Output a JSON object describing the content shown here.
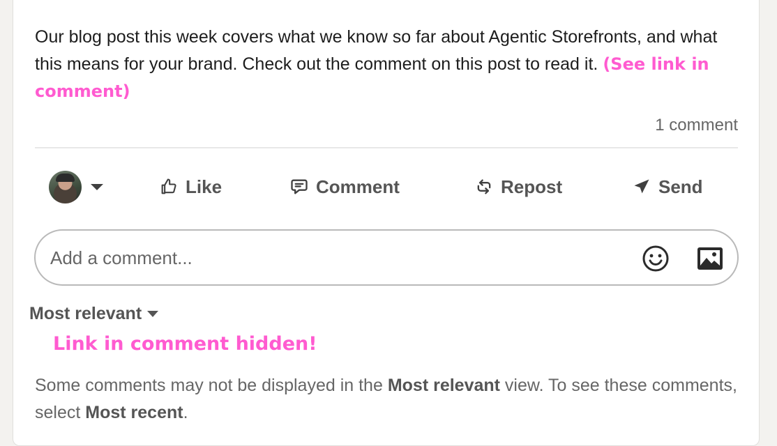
{
  "post": {
    "text": "Our blog post this week covers what we know so far about Agentic Storefronts, and what this means for your brand. Check out the comment on this post to read it.",
    "annotation": "(See link in comment)",
    "comment_count": "1 comment"
  },
  "actions": {
    "like": {
      "label": "Like",
      "icon": "thumbs-up-icon"
    },
    "comment": {
      "label": "Comment",
      "icon": "speech-bubble-icon"
    },
    "repost": {
      "label": "Repost",
      "icon": "repost-arrows-icon"
    },
    "send": {
      "label": "Send",
      "icon": "paper-plane-icon"
    }
  },
  "comment_box": {
    "placeholder": "Add a comment...",
    "emoji_icon": "smiley-icon",
    "image_icon": "image-icon"
  },
  "sort": {
    "label": "Most relevant"
  },
  "hidden_annotation": "Link in comment hidden!",
  "notice": {
    "part1": "Some comments may not be displayed in the ",
    "bold1": "Most relevant",
    "part2": " view. To see these comments, select ",
    "bold2": "Most recent",
    "part3": "."
  },
  "colors": {
    "annotation": "#ff5bd0",
    "muted_text": "#666666",
    "action_text": "#555555"
  }
}
